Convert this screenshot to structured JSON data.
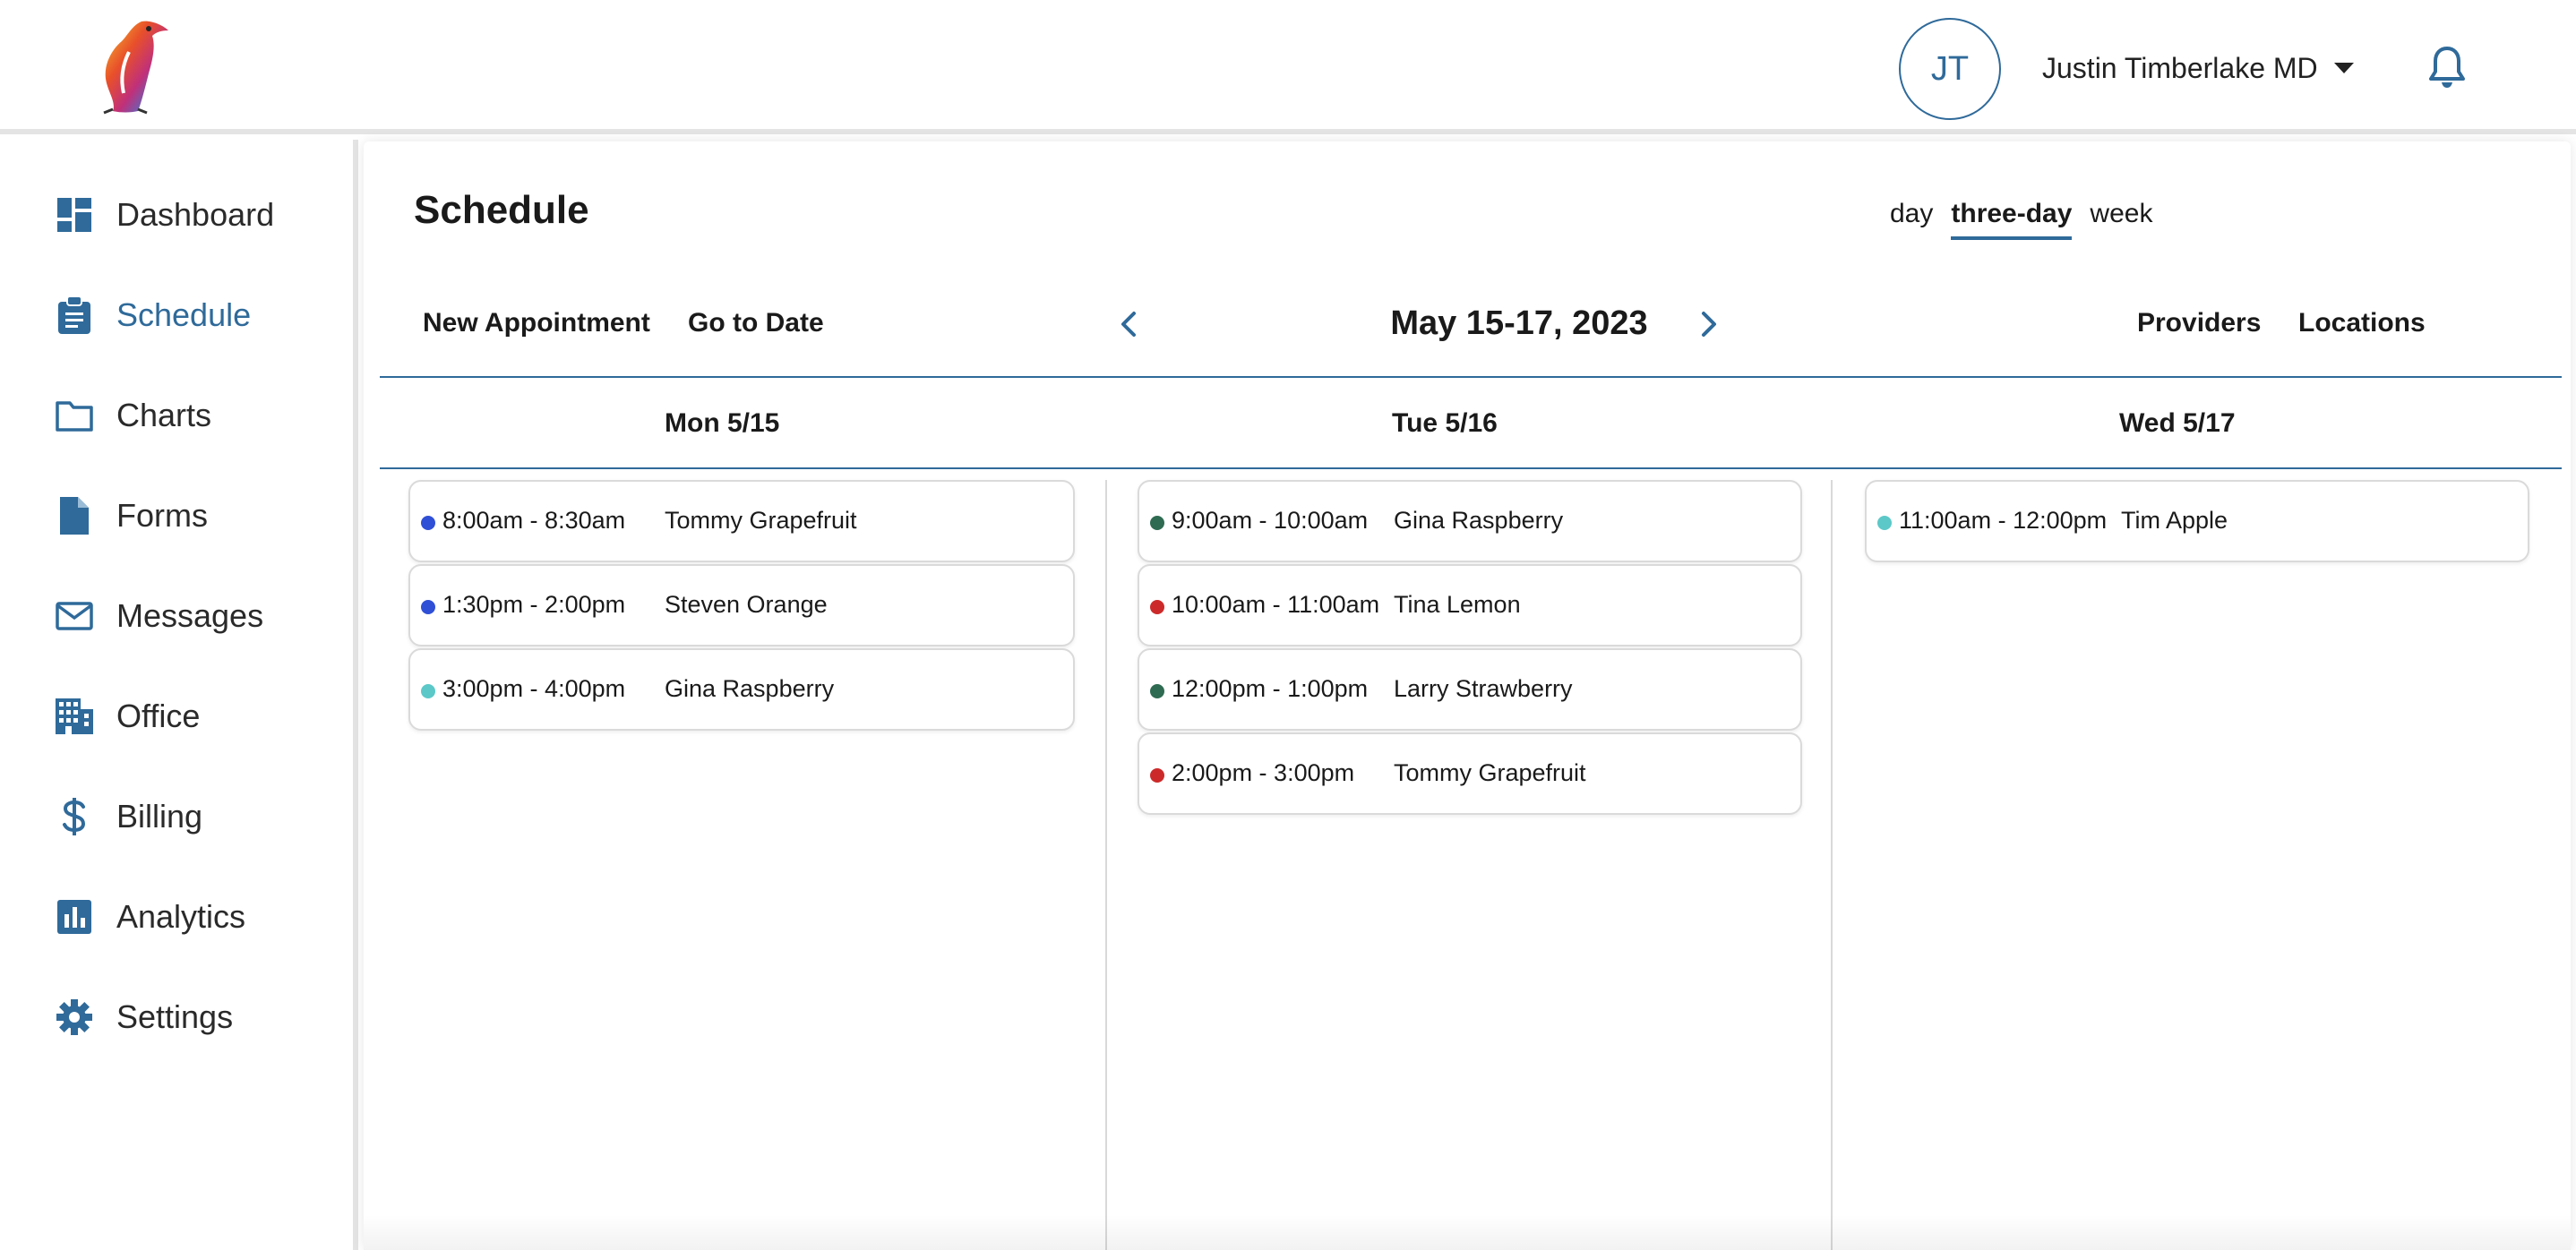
{
  "header": {
    "avatar_initials": "JT",
    "user_name": "Justin Timberlake MD"
  },
  "sidebar": {
    "items": [
      {
        "label": "Dashboard",
        "icon": "dashboard-icon"
      },
      {
        "label": "Schedule",
        "icon": "clipboard-icon",
        "active": true
      },
      {
        "label": "Charts",
        "icon": "folder-icon"
      },
      {
        "label": "Forms",
        "icon": "document-icon"
      },
      {
        "label": "Messages",
        "icon": "envelope-icon"
      },
      {
        "label": "Office",
        "icon": "building-icon"
      },
      {
        "label": "Billing",
        "icon": "dollar-icon"
      },
      {
        "label": "Analytics",
        "icon": "bar-chart-icon"
      },
      {
        "label": "Settings",
        "icon": "gear-icon"
      }
    ]
  },
  "main": {
    "title": "Schedule",
    "views": [
      {
        "label": "day"
      },
      {
        "label": "three-day",
        "active": true
      },
      {
        "label": "week"
      }
    ],
    "toolbar": {
      "new_appointment": "New Appointment",
      "go_to_date": "Go to Date",
      "date_range": "May 15-17, 2023",
      "providers": "Providers",
      "locations": "Locations"
    },
    "days": [
      {
        "label": "Mon 5/15",
        "appointments": [
          {
            "time": "8:00am - 8:30am",
            "patient": "Tommy Grapefruit",
            "color": "#2f4fd6"
          },
          {
            "time": "1:30pm - 2:00pm",
            "patient": "Steven Orange",
            "color": "#2f4fd6"
          },
          {
            "time": "3:00pm - 4:00pm",
            "patient": "Gina Raspberry",
            "color": "#5cc8c8"
          }
        ]
      },
      {
        "label": "Tue 5/16",
        "appointments": [
          {
            "time": "9:00am - 10:00am",
            "patient": "Gina Raspberry",
            "color": "#2f6b52"
          },
          {
            "time": "10:00am - 11:00am",
            "patient": "Tina Lemon",
            "color": "#cc2a2a"
          },
          {
            "time": "12:00pm - 1:00pm",
            "patient": "Larry Strawberry",
            "color": "#2f6b52"
          },
          {
            "time": "2:00pm - 3:00pm",
            "patient": "Tommy Grapefruit",
            "color": "#cc2a2a"
          }
        ]
      },
      {
        "label": "Wed 5/17",
        "appointments": [
          {
            "time": "11:00am - 12:00pm",
            "patient": "Tim Apple",
            "color": "#5cc8c8"
          }
        ]
      }
    ]
  },
  "colors": {
    "accent": "#2f6a9a",
    "sidebar_icon": "#2f6a9a",
    "divider": "#e4e4e4"
  }
}
